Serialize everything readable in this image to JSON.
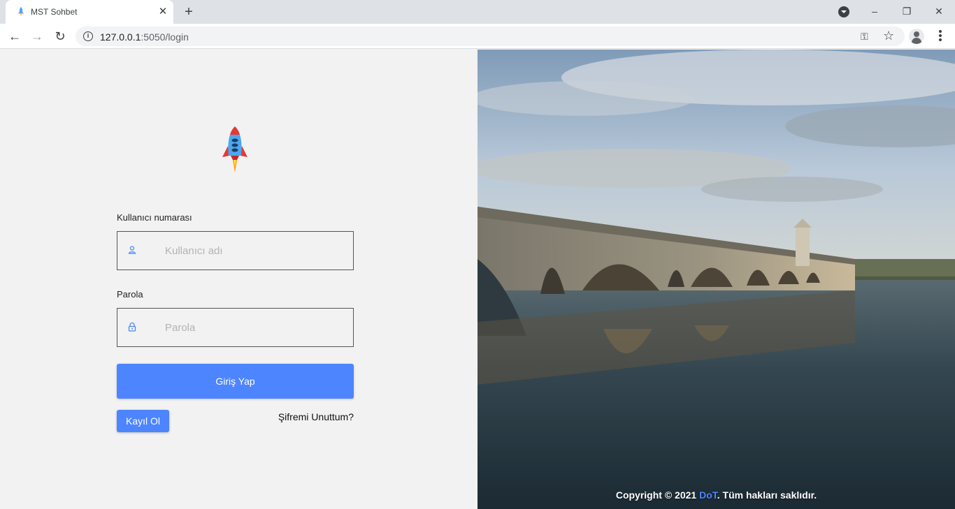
{
  "browser": {
    "tab_title": "MST Sohbet",
    "tab_close": "✕",
    "new_tab": "+",
    "url_host": "127.0.0.1",
    "url_path": ":5050/login",
    "window_minimize": "–",
    "window_restore": "❐",
    "window_close": "✕",
    "back": "←",
    "forward": "→",
    "reload": "↻"
  },
  "login": {
    "username_label": "Kullanıcı numarası",
    "username_placeholder": "Kullanıcı adı",
    "password_label": "Parola",
    "password_placeholder": "Parola",
    "submit_label": "Giriş Yap",
    "register_label": "Kayıl Ol",
    "forgot_label": "Şifremi Unuttum?"
  },
  "footer": {
    "prefix": "Copyright © 2021 ",
    "brand": "DoT",
    "suffix": ". Tüm hakları saklıdır."
  },
  "colors": {
    "accent": "#4c85ff",
    "rocket_body": "#4aa8f0",
    "rocket_fins": "#e53935"
  }
}
